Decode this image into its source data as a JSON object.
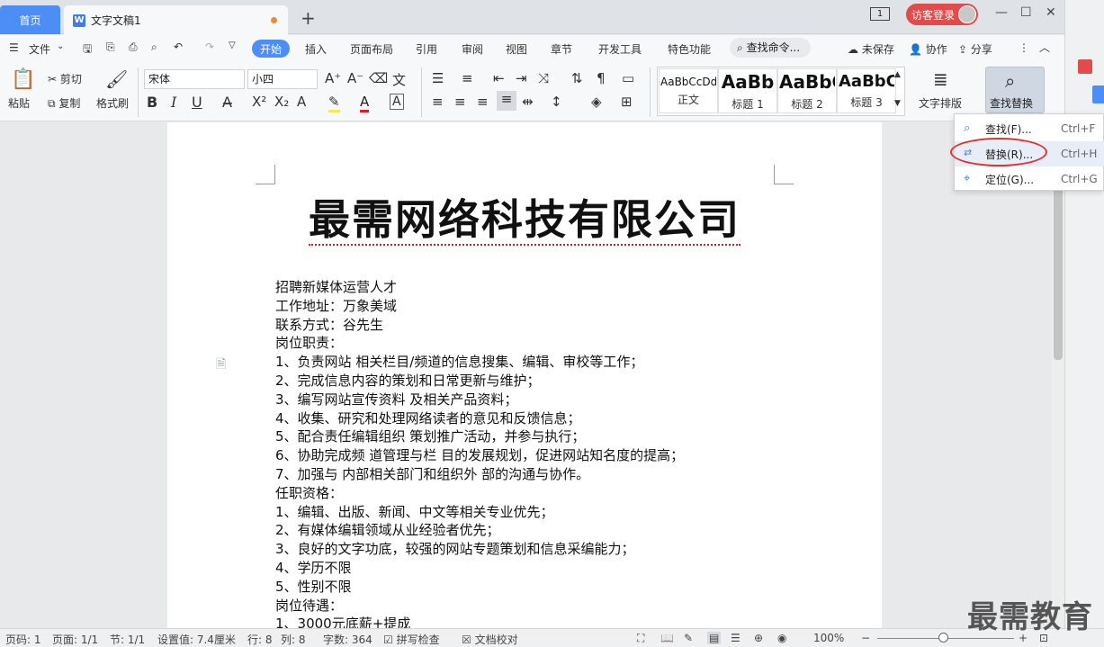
{
  "tabs": {
    "home": "首页",
    "document": "文字文稿1"
  },
  "titlebar": {
    "login": "访客登录",
    "page_indicator": "1"
  },
  "menus": {
    "file": "文件",
    "items": [
      "开始",
      "插入",
      "页面布局",
      "引用",
      "审阅",
      "视图",
      "章节",
      "开发工具",
      "特色功能"
    ],
    "search": "查找命令...",
    "unsaved": "未保存",
    "collab": "协作",
    "share": "分享"
  },
  "ribbon": {
    "paste": "粘贴",
    "cut": "剪切",
    "copy": "复制",
    "format_painter": "格式刷",
    "font_name": "宋体",
    "font_size": "小四",
    "styles": [
      {
        "preview": "AaBbCcDd",
        "label": "正文"
      },
      {
        "preview": "AaBb",
        "label": "标题 1"
      },
      {
        "preview": "AaBbC",
        "label": "标题 2"
      },
      {
        "preview": "AaBbC",
        "label": "标题 3"
      }
    ],
    "text_layout": "文字排版",
    "find_replace": "查找替换"
  },
  "dropdown": {
    "items": [
      {
        "label": "查找(F)...",
        "shortcut": "Ctrl+F"
      },
      {
        "label": "替换(R)...",
        "shortcut": "Ctrl+H"
      },
      {
        "label": "定位(G)...",
        "shortcut": "Ctrl+G"
      }
    ]
  },
  "document": {
    "title": "最需网络科技有限公司",
    "lines": [
      "招聘新媒体运营人才",
      "工作地址：万象美域",
      "联系方式：谷先生",
      "岗位职责：",
      "1、负责网站 相关栏目/频道的信息搜集、编辑、审校等工作；",
      "2、完成信息内容的策划和日常更新与维护；",
      "3、编写网站宣传资料 及相关产品资料；",
      "4、收集、研究和处理网络读者的意见和反馈信息；",
      "5、配合责任编辑组织  策划推广活动，并参与执行；",
      "6、协助完成频 道管理与栏 目的发展规划，促进网站知名度的提高；",
      "7、加强与  内部相关部门和组织外 部的沟通与协作。",
      "任职资格：",
      "1、编辑、出版、新闻、中文等相关专业优先；",
      "2、有媒体编辑领域从业经验者优先；",
      "3、良好的文字功底，较强的网站专题策划和信息采编能力；",
      "4、学历不限",
      "5、性别不限",
      "岗位待遇：",
      "1、3000元底薪+提成"
    ]
  },
  "status": {
    "page_num": "页码: 1",
    "pages": "页面: 1/1",
    "section": "节: 1/1",
    "setting": "设置值: 7.4厘米",
    "row": "行: 8",
    "col": "列: 8",
    "words": "字数: 364",
    "spell": "拼写检查",
    "proof": "文档校对",
    "zoom": "100%"
  },
  "watermark": "最需教育"
}
